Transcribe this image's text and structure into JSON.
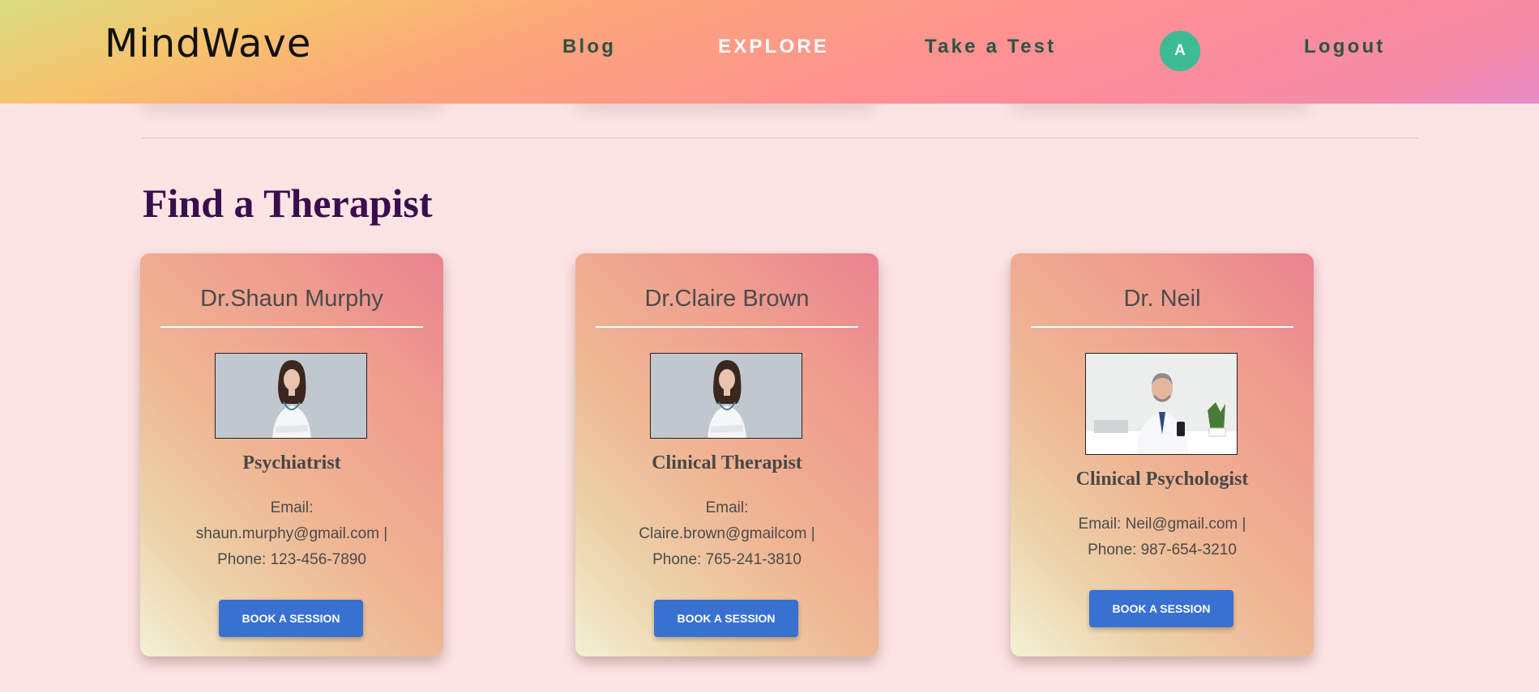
{
  "brand": "MindWave",
  "nav": {
    "blog": "Blog",
    "explore": "EXPLORE",
    "test": "Take a Test",
    "avatar_initial": "A",
    "logout": "Logout"
  },
  "section_title": "Find a Therapist",
  "therapists": [
    {
      "name": "Dr.Shaun Murphy",
      "role": "Psychiatrist",
      "email_label": "Email:",
      "email_line": "shaun.murphy@gmail.com |",
      "phone_line": "Phone: 123-456-7890",
      "button": "BOOK A SESSION"
    },
    {
      "name": "Dr.Claire Brown",
      "role": "Clinical Therapist",
      "email_label": "Email:",
      "email_line": "Claire.brown@gmailcom |",
      "phone_line": "Phone: 765-241-3810",
      "button": "BOOK A SESSION"
    },
    {
      "name": "Dr. Neil",
      "role": "Clinical Psychologist",
      "email_line": "Email: Neil@gmail.com |",
      "phone_line": "Phone: 987-654-3210",
      "button": "BOOK A SESSION"
    }
  ],
  "colors": {
    "accent_button": "#3871d0",
    "avatar": "#3dbb93",
    "title": "#3a0e4c",
    "nav_text": "#2f5244"
  }
}
